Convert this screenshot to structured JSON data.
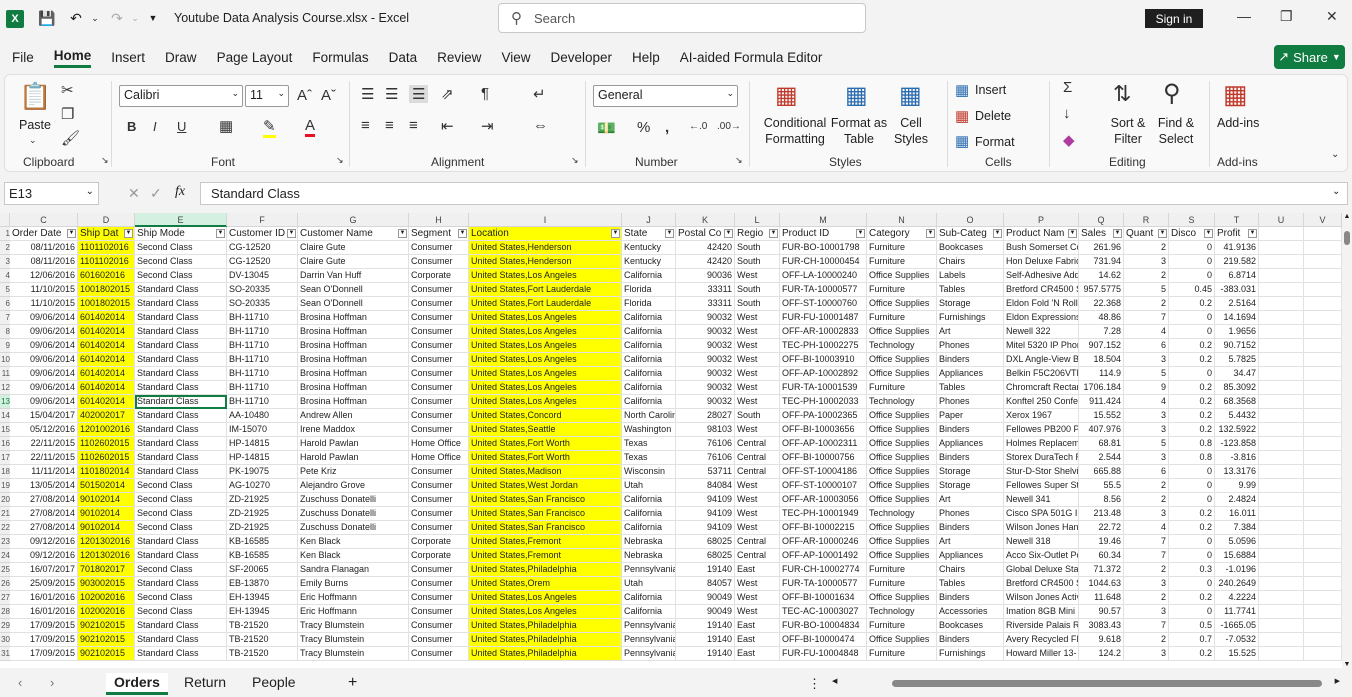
{
  "app": {
    "title": "Youtube Data Analysis Course.xlsx  -  Excel",
    "search_placeholder": "Search",
    "signin_label": "Sign in",
    "share_label": "Share",
    "accent_color": "#107c41"
  },
  "menu": [
    "File",
    "Home",
    "Insert",
    "Draw",
    "Page Layout",
    "Formulas",
    "Data",
    "Review",
    "View",
    "Developer",
    "Help",
    "AI-aided Formula Editor"
  ],
  "ribbon": {
    "clipboard": {
      "label": "Clipboard",
      "paste": "Paste"
    },
    "font": {
      "label": "Font",
      "font_name": "Calibri",
      "font_size": "11"
    },
    "alignment": {
      "label": "Alignment"
    },
    "number": {
      "label": "Number",
      "format": "General"
    },
    "styles": {
      "label": "Styles",
      "conditional": "Conditional Formatting",
      "format_table": "Format as Table",
      "cell_styles": "Cell Styles"
    },
    "cells": {
      "label": "Cells",
      "insert": "Insert",
      "delete": "Delete",
      "format": "Format"
    },
    "editing": {
      "label": "Editing",
      "sort": "Sort & Filter",
      "find": "Find & Select"
    },
    "addins": {
      "label": "Add-ins",
      "addins": "Add-ins"
    }
  },
  "formula_bar": {
    "name_box": "E13",
    "formula": "Standard Class",
    "fx": "fx"
  },
  "columns": [
    "C",
    "D",
    "E",
    "F",
    "G",
    "H",
    "I",
    "J",
    "K",
    "L",
    "M",
    "N",
    "O",
    "P",
    "Q",
    "R",
    "S",
    "T",
    "U",
    "V"
  ],
  "headers": [
    "Order Date",
    "Ship Dat",
    "Ship Mode",
    "Customer ID",
    "Customer Name",
    "Segment",
    "Location",
    "State",
    "Postal Co",
    "Regio",
    "Product ID",
    "Category",
    "Sub-Categ",
    "Product Nam",
    "Sales",
    "Quant",
    "Disco",
    "Profit"
  ],
  "rows": [
    [
      "2",
      "08/11/2016",
      "1101102016",
      "Second Class",
      "CG-12520",
      "Claire Gute",
      "Consumer",
      "United States,Henderson",
      "Kentucky",
      "42420",
      "South",
      "FUR-BO-10001798",
      "Furniture",
      "Bookcases",
      "Bush Somerset Col",
      "261.96",
      "2",
      "0",
      "41.9136"
    ],
    [
      "3",
      "08/11/2016",
      "1101102016",
      "Second Class",
      "CG-12520",
      "Claire Gute",
      "Consumer",
      "United States,Henderson",
      "Kentucky",
      "42420",
      "South",
      "FUR-CH-10000454",
      "Furniture",
      "Chairs",
      "Hon Deluxe Fabric",
      "731.94",
      "3",
      "0",
      "219.582"
    ],
    [
      "4",
      "12/06/2016",
      "601602016",
      "Second Class",
      "DV-13045",
      "Darrin Van Huff",
      "Corporate",
      "United States,Los Angeles",
      "California",
      "90036",
      "West",
      "OFF-LA-10000240",
      "Office Supplies",
      "Labels",
      "Self-Adhesive Add",
      "14.62",
      "2",
      "0",
      "6.8714"
    ],
    [
      "5",
      "11/10/2015",
      "1001802015",
      "Standard Class",
      "SO-20335",
      "Sean O'Donnell",
      "Consumer",
      "United States,Fort Lauderdale",
      "Florida",
      "33311",
      "South",
      "FUR-TA-10000577",
      "Furniture",
      "Tables",
      "Bretford CR4500 S",
      "957.5775",
      "5",
      "0.45",
      "-383.031"
    ],
    [
      "6",
      "11/10/2015",
      "1001802015",
      "Standard Class",
      "SO-20335",
      "Sean O'Donnell",
      "Consumer",
      "United States,Fort Lauderdale",
      "Florida",
      "33311",
      "South",
      "OFF-ST-10000760",
      "Office Supplies",
      "Storage",
      "Eldon Fold 'N Roll C",
      "22.368",
      "2",
      "0.2",
      "2.5164"
    ],
    [
      "7",
      "09/06/2014",
      "601402014",
      "Standard Class",
      "BH-11710",
      "Brosina Hoffman",
      "Consumer",
      "United States,Los Angeles",
      "California",
      "90032",
      "West",
      "FUR-FU-10001487",
      "Furniture",
      "Furnishings",
      "Eldon Expressions",
      "48.86",
      "7",
      "0",
      "14.1694"
    ],
    [
      "8",
      "09/06/2014",
      "601402014",
      "Standard Class",
      "BH-11710",
      "Brosina Hoffman",
      "Consumer",
      "United States,Los Angeles",
      "California",
      "90032",
      "West",
      "OFF-AR-10002833",
      "Office Supplies",
      "Art",
      "Newell 322",
      "7.28",
      "4",
      "0",
      "1.9656"
    ],
    [
      "9",
      "09/06/2014",
      "601402014",
      "Standard Class",
      "BH-11710",
      "Brosina Hoffman",
      "Consumer",
      "United States,Los Angeles",
      "California",
      "90032",
      "West",
      "TEC-PH-10002275",
      "Technology",
      "Phones",
      "Mitel 5320 IP Phon",
      "907.152",
      "6",
      "0.2",
      "90.7152"
    ],
    [
      "10",
      "09/06/2014",
      "601402014",
      "Standard Class",
      "BH-11710",
      "Brosina Hoffman",
      "Consumer",
      "United States,Los Angeles",
      "California",
      "90032",
      "West",
      "OFF-BI-10003910",
      "Office Supplies",
      "Binders",
      "DXL Angle-View Bi",
      "18.504",
      "3",
      "0.2",
      "5.7825"
    ],
    [
      "11",
      "09/06/2014",
      "601402014",
      "Standard Class",
      "BH-11710",
      "Brosina Hoffman",
      "Consumer",
      "United States,Los Angeles",
      "California",
      "90032",
      "West",
      "OFF-AP-10002892",
      "Office Supplies",
      "Appliances",
      "Belkin F5C206VTE",
      "114.9",
      "5",
      "0",
      "34.47"
    ],
    [
      "12",
      "09/06/2014",
      "601402014",
      "Standard Class",
      "BH-11710",
      "Brosina Hoffman",
      "Consumer",
      "United States,Los Angeles",
      "California",
      "90032",
      "West",
      "FUR-TA-10001539",
      "Furniture",
      "Tables",
      "Chromcraft Rectan",
      "1706.184",
      "9",
      "0.2",
      "85.3092"
    ],
    [
      "13",
      "09/06/2014",
      "601402014",
      "Standard Class",
      "BH-11710",
      "Brosina Hoffman",
      "Consumer",
      "United States,Los Angeles",
      "California",
      "90032",
      "West",
      "TEC-PH-10002033",
      "Technology",
      "Phones",
      "Konftel 250 Confer",
      "911.424",
      "4",
      "0.2",
      "68.3568"
    ],
    [
      "14",
      "15/04/2017",
      "402002017",
      "Standard Class",
      "AA-10480",
      "Andrew Allen",
      "Consumer",
      "United States,Concord",
      "North Carolin",
      "28027",
      "South",
      "OFF-PA-10002365",
      "Office Supplies",
      "Paper",
      "Xerox 1967",
      "15.552",
      "3",
      "0.2",
      "5.4432"
    ],
    [
      "15",
      "05/12/2016",
      "1201002016",
      "Standard Class",
      "IM-15070",
      "Irene Maddox",
      "Consumer",
      "United States,Seattle",
      "Washington",
      "98103",
      "West",
      "OFF-BI-10003656",
      "Office Supplies",
      "Binders",
      "Fellowes PB200 Pl",
      "407.976",
      "3",
      "0.2",
      "132.5922"
    ],
    [
      "16",
      "22/11/2015",
      "1102602015",
      "Standard Class",
      "HP-14815",
      "Harold Pawlan",
      "Home Office",
      "United States,Fort Worth",
      "Texas",
      "76106",
      "Central",
      "OFF-AP-10002311",
      "Office Supplies",
      "Appliances",
      "Holmes Replacem",
      "68.81",
      "5",
      "0.8",
      "-123.858"
    ],
    [
      "17",
      "22/11/2015",
      "1102602015",
      "Standard Class",
      "HP-14815",
      "Harold Pawlan",
      "Home Office",
      "United States,Fort Worth",
      "Texas",
      "76106",
      "Central",
      "OFF-BI-10000756",
      "Office Supplies",
      "Binders",
      "Storex DuraTech R",
      "2.544",
      "3",
      "0.8",
      "-3.816"
    ],
    [
      "18",
      "11/11/2014",
      "1101802014",
      "Standard Class",
      "PK-19075",
      "Pete Kriz",
      "Consumer",
      "United States,Madison",
      "Wisconsin",
      "53711",
      "Central",
      "OFF-ST-10004186",
      "Office Supplies",
      "Storage",
      "Stur-D-Stor Shelvi",
      "665.88",
      "6",
      "0",
      "13.3176"
    ],
    [
      "19",
      "13/05/2014",
      "501502014",
      "Second Class",
      "AG-10270",
      "Alejandro Grove",
      "Consumer",
      "United States,West Jordan",
      "Utah",
      "84084",
      "West",
      "OFF-ST-10000107",
      "Office Supplies",
      "Storage",
      "Fellowes Super Sto",
      "55.5",
      "2",
      "0",
      "9.99"
    ],
    [
      "20",
      "27/08/2014",
      "90102014",
      "Second Class",
      "ZD-21925",
      "Zuschuss Donatelli",
      "Consumer",
      "United States,San Francisco",
      "California",
      "94109",
      "West",
      "OFF-AR-10003056",
      "Office Supplies",
      "Art",
      "Newell 341",
      "8.56",
      "2",
      "0",
      "2.4824"
    ],
    [
      "21",
      "27/08/2014",
      "90102014",
      "Second Class",
      "ZD-21925",
      "Zuschuss Donatelli",
      "Consumer",
      "United States,San Francisco",
      "California",
      "94109",
      "West",
      "TEC-PH-10001949",
      "Technology",
      "Phones",
      "Cisco SPA 501G IP",
      "213.48",
      "3",
      "0.2",
      "16.011"
    ],
    [
      "22",
      "27/08/2014",
      "90102014",
      "Second Class",
      "ZD-21925",
      "Zuschuss Donatelli",
      "Consumer",
      "United States,San Francisco",
      "California",
      "94109",
      "West",
      "OFF-BI-10002215",
      "Office Supplies",
      "Binders",
      "Wilson Jones Hang",
      "22.72",
      "4",
      "0.2",
      "7.384"
    ],
    [
      "23",
      "09/12/2016",
      "1201302016",
      "Standard Class",
      "KB-16585",
      "Ken Black",
      "Corporate",
      "United States,Fremont",
      "Nebraska",
      "68025",
      "Central",
      "OFF-AR-10000246",
      "Office Supplies",
      "Art",
      "Newell 318",
      "19.46",
      "7",
      "0",
      "5.0596"
    ],
    [
      "24",
      "09/12/2016",
      "1201302016",
      "Standard Class",
      "KB-16585",
      "Ken Black",
      "Corporate",
      "United States,Fremont",
      "Nebraska",
      "68025",
      "Central",
      "OFF-AP-10001492",
      "Office Supplies",
      "Appliances",
      "Acco Six-Outlet Po",
      "60.34",
      "7",
      "0",
      "15.6884"
    ],
    [
      "25",
      "16/07/2017",
      "701802017",
      "Second Class",
      "SF-20065",
      "Sandra Flanagan",
      "Consumer",
      "United States,Philadelphia",
      "Pennsylvania",
      "19140",
      "East",
      "FUR-CH-10002774",
      "Furniture",
      "Chairs",
      "Global Deluxe Stac",
      "71.372",
      "2",
      "0.3",
      "-1.0196"
    ],
    [
      "26",
      "25/09/2015",
      "903002015",
      "Standard Class",
      "EB-13870",
      "Emily Burns",
      "Consumer",
      "United States,Orem",
      "Utah",
      "84057",
      "West",
      "FUR-TA-10000577",
      "Furniture",
      "Tables",
      "Bretford CR4500 S",
      "1044.63",
      "3",
      "0",
      "240.2649"
    ],
    [
      "27",
      "16/01/2016",
      "102002016",
      "Second Class",
      "EH-13945",
      "Eric Hoffmann",
      "Consumer",
      "United States,Los Angeles",
      "California",
      "90049",
      "West",
      "OFF-BI-10001634",
      "Office Supplies",
      "Binders",
      "Wilson Jones Activ",
      "11.648",
      "2",
      "0.2",
      "4.2224"
    ],
    [
      "28",
      "16/01/2016",
      "102002016",
      "Second Class",
      "EH-13945",
      "Eric Hoffmann",
      "Consumer",
      "United States,Los Angeles",
      "California",
      "90049",
      "West",
      "TEC-AC-10003027",
      "Technology",
      "Accessories",
      "Imation 8GB Mini",
      "90.57",
      "3",
      "0",
      "11.7741"
    ],
    [
      "29",
      "17/09/2015",
      "902102015",
      "Standard Class",
      "TB-21520",
      "Tracy Blumstein",
      "Consumer",
      "United States,Philadelphia",
      "Pennsylvania",
      "19140",
      "East",
      "FUR-BO-10004834",
      "Furniture",
      "Bookcases",
      "Riverside Palais Ro",
      "3083.43",
      "7",
      "0.5",
      "-1665.05"
    ],
    [
      "30",
      "17/09/2015",
      "902102015",
      "Standard Class",
      "TB-21520",
      "Tracy Blumstein",
      "Consumer",
      "United States,Philadelphia",
      "Pennsylvania",
      "19140",
      "East",
      "OFF-BI-10000474",
      "Office Supplies",
      "Binders",
      "Avery Recycled Fl",
      "9.618",
      "2",
      "0.7",
      "-7.0532"
    ],
    [
      "31",
      "17/09/2015",
      "902102015",
      "Standard Class",
      "TB-21520",
      "Tracy Blumstein",
      "Consumer",
      "United States,Philadelphia",
      "Pennsylvania",
      "19140",
      "East",
      "FUR-FU-10004848",
      "Furniture",
      "Furnishings",
      "Howard Miller 13-",
      "124.2",
      "3",
      "0.2",
      "15.525"
    ]
  ],
  "sheets": [
    "Orders",
    "Return",
    "People"
  ],
  "highlight_color": "#ffff00"
}
